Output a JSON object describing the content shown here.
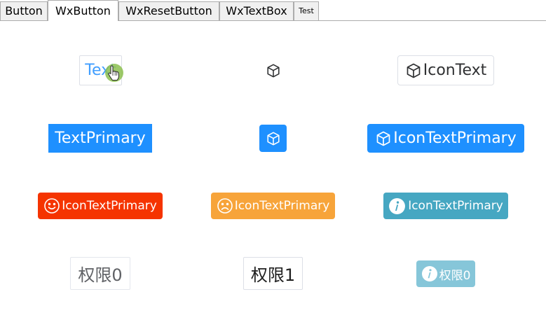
{
  "tabs": [
    {
      "label": "Button"
    },
    {
      "label": "WxButton"
    },
    {
      "label": "WxResetButton"
    },
    {
      "label": "WxTextBox"
    },
    {
      "label": "Test"
    }
  ],
  "selected_tab": "WxButton",
  "buttons": {
    "text": {
      "label": "Text"
    },
    "icon": {
      "icon": "cube-icon"
    },
    "icon_text": {
      "label": "IconText",
      "icon": "cube-icon"
    },
    "text_primary": {
      "label": "TextPrimary"
    },
    "icon_primary": {
      "icon": "cube-icon"
    },
    "icon_text_primary": {
      "label": "IconTextPrimary",
      "icon": "cube-icon"
    },
    "danger": {
      "label": "IconTextPrimary",
      "icon": "smile-icon"
    },
    "warning": {
      "label": "IconTextPrimary",
      "icon": "frown-icon"
    },
    "info": {
      "label": "IconTextPrimary",
      "icon": "info-circle-icon"
    },
    "permission0": {
      "label": "权限0"
    },
    "permission1": {
      "label": "权限1"
    },
    "permission0_disabled": {
      "label": "权限0",
      "icon": "info-circle-icon"
    }
  },
  "colors": {
    "primary": "#1e90ff",
    "danger": "#f53400",
    "warning": "#f7a43a",
    "info": "#46a7c2",
    "info_disabled": "#86c6d9",
    "text_link": "#409eff",
    "cursor_highlight": "#8cbf4f"
  }
}
